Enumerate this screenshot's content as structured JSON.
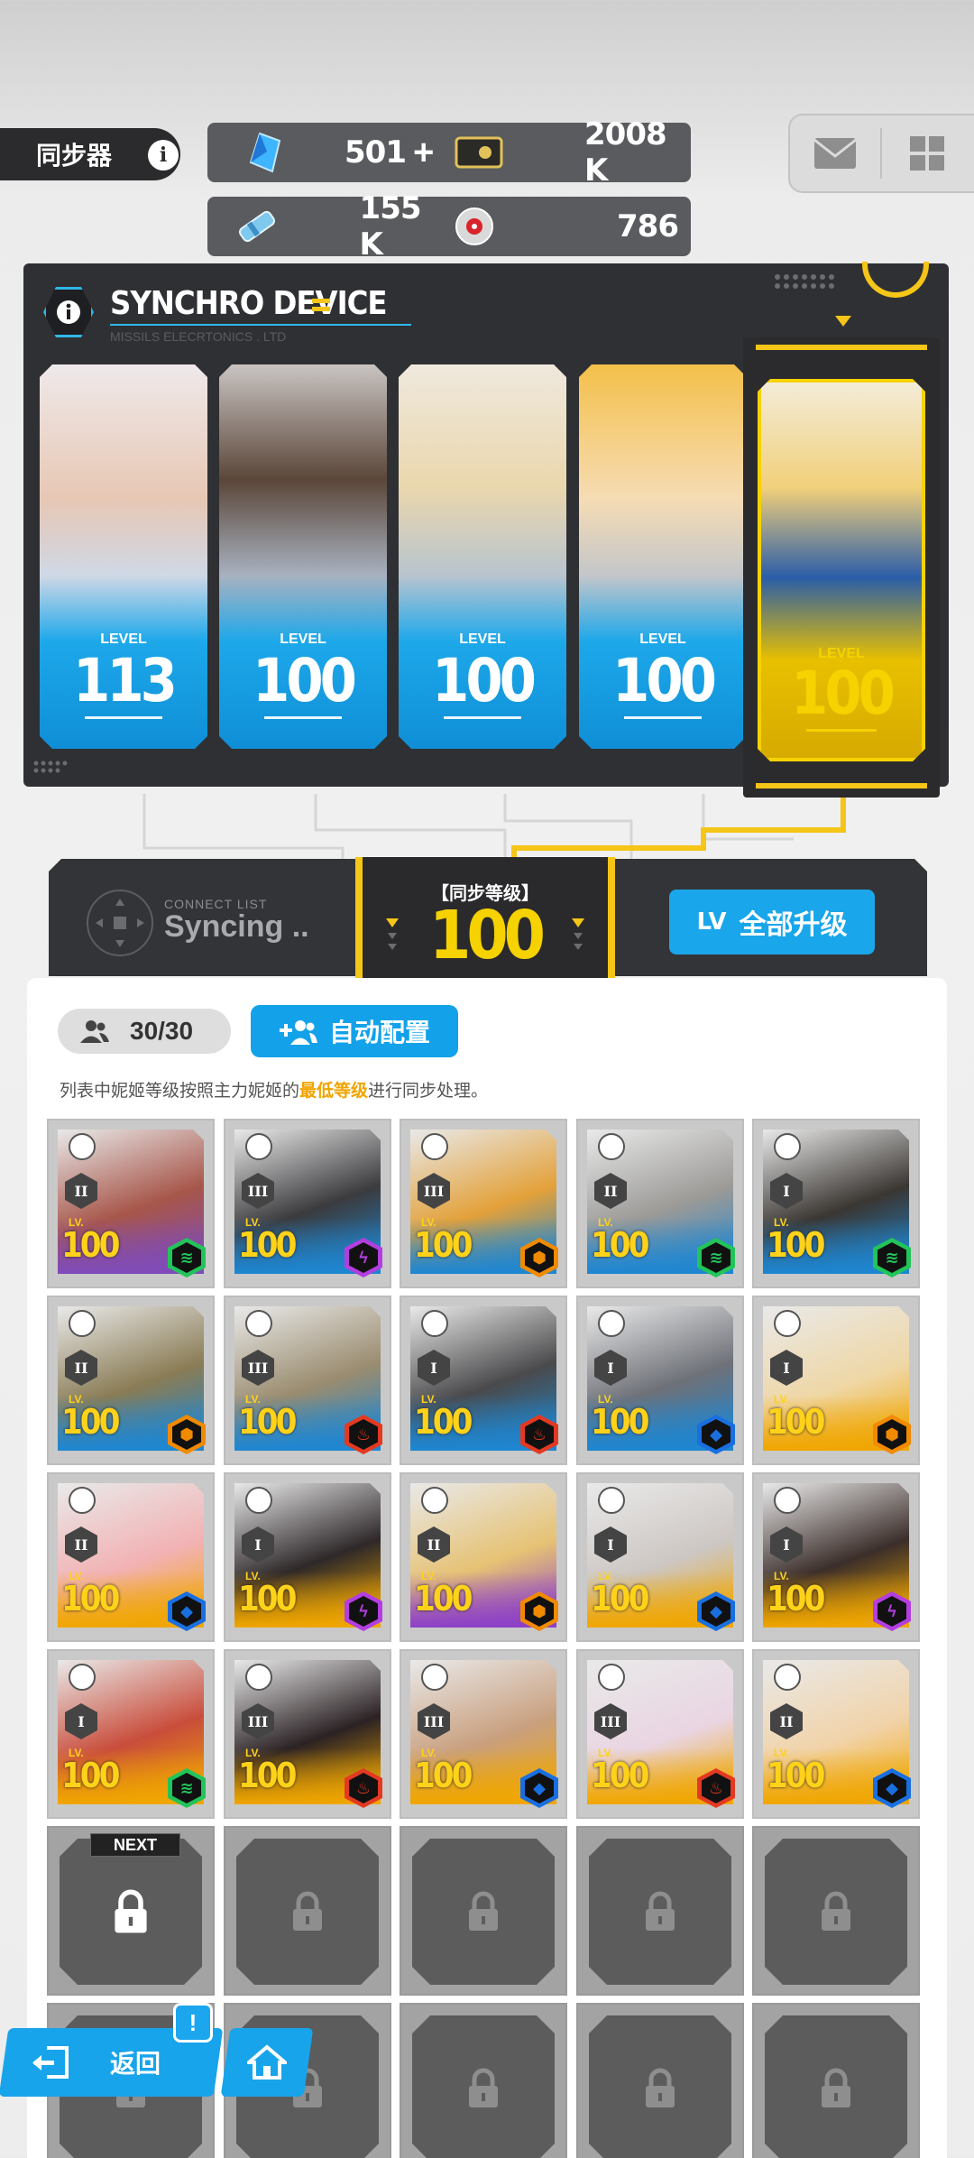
{
  "header": {
    "title": "同步器",
    "info_symbol": "i",
    "resources": [
      {
        "icon": "gem-icon",
        "value": "501",
        "has_plus": true,
        "plus": "+"
      },
      {
        "icon": "credit-icon",
        "value": "2008 K"
      },
      {
        "icon": "battle-data-icon",
        "value": "155 K"
      },
      {
        "icon": "core-dust-icon",
        "value": "786"
      }
    ]
  },
  "device": {
    "title": "SYNCHRO DEVICE",
    "subtitle": "MISSILS ELECRTONICS . LTD",
    "level_label": "LEVEL",
    "cards": [
      {
        "level": "113",
        "colors": [
          "#e7c7b4",
          "#1da8ea"
        ]
      },
      {
        "level": "100",
        "colors": [
          "#5b4639",
          "#1da8ea"
        ]
      },
      {
        "level": "100",
        "colors": [
          "#ead7ad",
          "#1da8ea"
        ]
      },
      {
        "level": "100",
        "colors": [
          "#f4c04a",
          "#1da8ea"
        ]
      },
      {
        "level": "100",
        "colors": [
          "#f2d07a",
          "#e8c000"
        ]
      }
    ]
  },
  "connect": {
    "small": "CONNECT LIST",
    "big": "Syncing ..",
    "level_label": "【同步等级】",
    "level_value": "100",
    "upgrade_lv": "LV",
    "upgrade_label": "全部升级"
  },
  "list": {
    "count": "30/30",
    "auto_label": "自动配置",
    "note_prefix": "列表中妮姬等级按照主力妮姬的",
    "note_highlight": "最低等级",
    "note_suffix": "进行同步处理。",
    "lv_tag": "LV.",
    "slots": [
      {
        "burst": "II",
        "level": "100",
        "bg": "#7f4bb8",
        "face": "#a7564a",
        "element": "wind"
      },
      {
        "burst": "III",
        "level": "100",
        "bg": "#1e86d1",
        "face": "#3b3b3e",
        "element": "electric"
      },
      {
        "burst": "III",
        "level": "100",
        "bg": "#1e86d1",
        "face": "#e3a13a",
        "element": "iron"
      },
      {
        "burst": "II",
        "level": "100",
        "bg": "#1e86d1",
        "face": "#9b9a97",
        "element": "wind"
      },
      {
        "burst": "I",
        "level": "100",
        "bg": "#1e86d1",
        "face": "#3a3632",
        "element": "wind"
      },
      {
        "burst": "II",
        "level": "100",
        "bg": "#1e86d1",
        "face": "#8a7c55",
        "element": "iron"
      },
      {
        "burst": "III",
        "level": "100",
        "bg": "#1e86d1",
        "face": "#9a8c6f",
        "element": "fire"
      },
      {
        "burst": "I",
        "level": "100",
        "bg": "#1e86d1",
        "face": "#4a4a4c",
        "element": "fire"
      },
      {
        "burst": "I",
        "level": "100",
        "bg": "#1e86d1",
        "face": "#6e7178",
        "element": "water"
      },
      {
        "burst": "I",
        "level": "100",
        "bg": "#f0a600",
        "face": "#efd7a6",
        "element": "iron"
      },
      {
        "burst": "II",
        "level": "100",
        "bg": "#f0a600",
        "face": "#f2b2b4",
        "element": "water"
      },
      {
        "burst": "I",
        "level": "100",
        "bg": "#f0a600",
        "face": "#2e2829",
        "element": "electric"
      },
      {
        "burst": "II",
        "level": "100",
        "bg": "#8d40c7",
        "face": "#e6c274",
        "element": "iron"
      },
      {
        "burst": "I",
        "level": "100",
        "bg": "#f0a600",
        "face": "#cdc7c3",
        "element": "water"
      },
      {
        "burst": "I",
        "level": "100",
        "bg": "#f0a600",
        "face": "#3b2e2a",
        "element": "electric"
      },
      {
        "burst": "I",
        "level": "100",
        "bg": "#f0a600",
        "face": "#c94d3b",
        "element": "wind"
      },
      {
        "burst": "III",
        "level": "100",
        "bg": "#f0a600",
        "face": "#2b2224",
        "element": "fire"
      },
      {
        "burst": "III",
        "level": "100",
        "bg": "#f0a600",
        "face": "#c9a07f",
        "element": "water"
      },
      {
        "burst": "III",
        "level": "100",
        "bg": "#f0a600",
        "face": "#e9d5e2",
        "element": "fire"
      },
      {
        "burst": "II",
        "level": "100",
        "bg": "#f0a600",
        "face": "#f1d3a9",
        "element": "water"
      }
    ],
    "next_label": "NEXT"
  },
  "nav": {
    "back_label": "返回",
    "alert": "!"
  },
  "colors": {
    "accent_blue": "#1aa6ea",
    "accent_yellow": "#f5c518",
    "element_wind": "#22c45a",
    "element_electric": "#b33ee0",
    "element_fire": "#e23a22",
    "element_water": "#1a6fe0",
    "element_iron": "#f08a00"
  }
}
